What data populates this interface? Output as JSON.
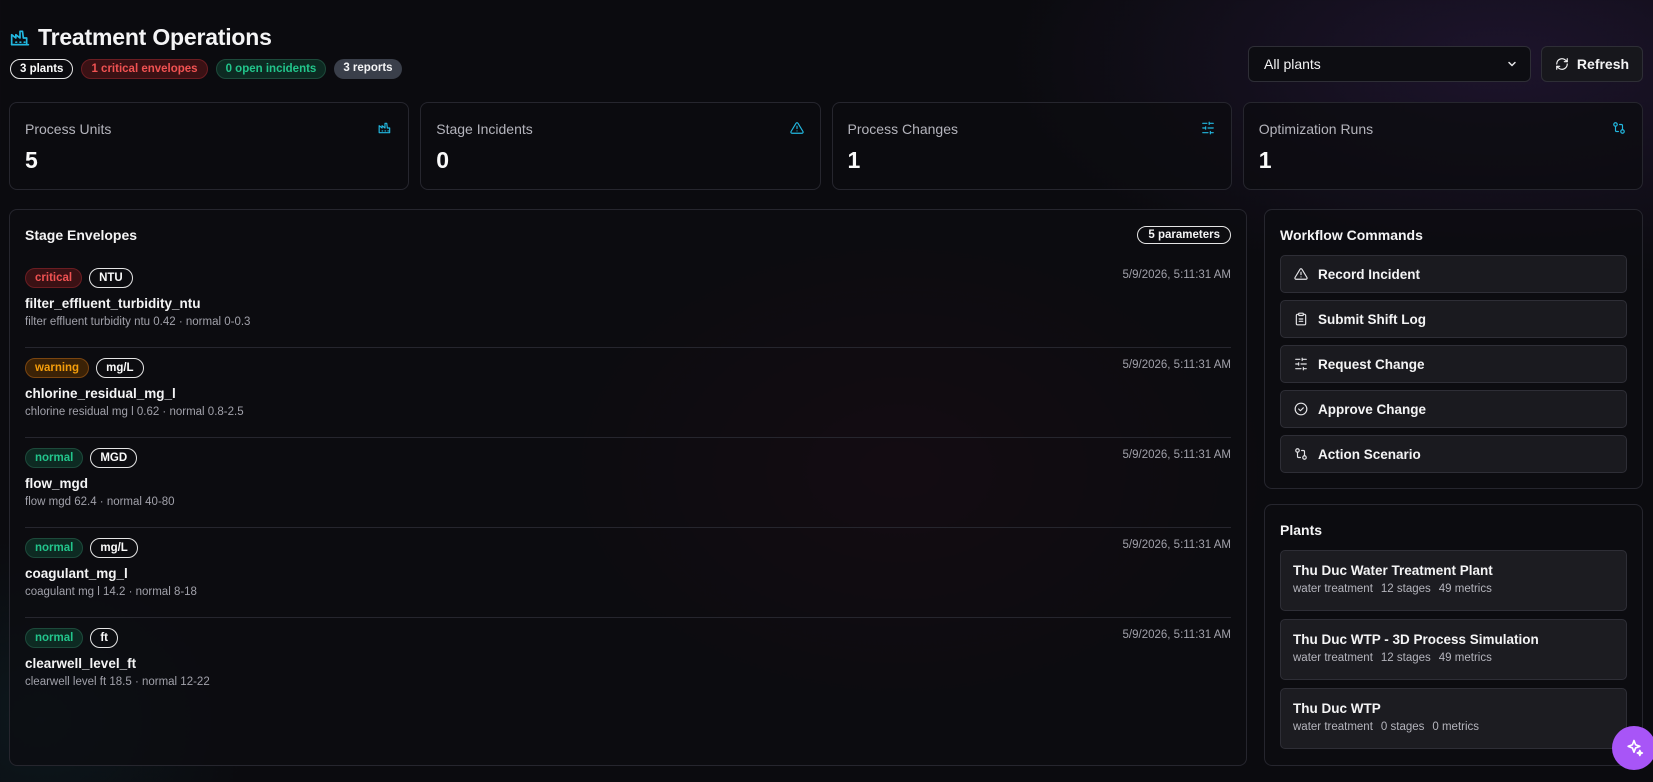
{
  "header": {
    "title": "Treatment Operations",
    "icon": "factory-icon",
    "badges": [
      "3 plants",
      "1 critical envelopes",
      "0 open incidents",
      "3 reports"
    ]
  },
  "controls": {
    "plant_select": "All plants",
    "refresh_label": "Refresh"
  },
  "stats": [
    {
      "label": "Process Units",
      "value": "5",
      "icon": "factory-icon"
    },
    {
      "label": "Stage Incidents",
      "value": "0",
      "icon": "alert-triangle-icon"
    },
    {
      "label": "Process Changes",
      "value": "1",
      "icon": "sliders-icon"
    },
    {
      "label": "Optimization Runs",
      "value": "1",
      "icon": "git-compare-icon"
    }
  ],
  "envelopes": {
    "title": "Stage Envelopes",
    "count_badge": "5 parameters",
    "items": [
      {
        "status": "critical",
        "unit": "NTU",
        "time": "5/9/2026, 5:11:31 AM",
        "name": "filter_effluent_turbidity_ntu",
        "desc": "filter effluent turbidity ntu 0.42 · normal 0-0.3"
      },
      {
        "status": "warning",
        "unit": "mg/L",
        "time": "5/9/2026, 5:11:31 AM",
        "name": "chlorine_residual_mg_l",
        "desc": "chlorine residual mg l 0.62 · normal 0.8-2.5"
      },
      {
        "status": "normal",
        "unit": "MGD",
        "time": "5/9/2026, 5:11:31 AM",
        "name": "flow_mgd",
        "desc": "flow mgd 62.4 · normal 40-80"
      },
      {
        "status": "normal",
        "unit": "mg/L",
        "time": "5/9/2026, 5:11:31 AM",
        "name": "coagulant_mg_l",
        "desc": "coagulant mg l 14.2 · normal 8-18"
      },
      {
        "status": "normal",
        "unit": "ft",
        "time": "5/9/2026, 5:11:31 AM",
        "name": "clearwell_level_ft",
        "desc": "clearwell level ft 18.5 · normal 12-22"
      }
    ]
  },
  "workflow": {
    "title": "Workflow Commands",
    "commands": [
      {
        "label": "Record Incident",
        "icon": "alert-triangle-icon"
      },
      {
        "label": "Submit Shift Log",
        "icon": "clipboard-icon"
      },
      {
        "label": "Request Change",
        "icon": "sliders-icon"
      },
      {
        "label": "Approve Change",
        "icon": "check-circle-icon"
      },
      {
        "label": "Action Scenario",
        "icon": "git-compare-icon"
      }
    ]
  },
  "plants": {
    "title": "Plants",
    "items": [
      {
        "name": "Thu Duc Water Treatment Plant",
        "type": "water treatment",
        "stages": "12 stages",
        "metrics": "49 metrics"
      },
      {
        "name": "Thu Duc WTP - 3D Process Simulation",
        "type": "water treatment",
        "stages": "12 stages",
        "metrics": "49 metrics"
      },
      {
        "name": "Thu Duc WTP",
        "type": "water treatment",
        "stages": "0 stages",
        "metrics": "0 metrics"
      }
    ]
  },
  "colors": {
    "accent": "#22b8e0",
    "critical": "#f05252",
    "warning": "#f59e0b",
    "normal": "#22c58b",
    "fab": "#a855f7"
  }
}
